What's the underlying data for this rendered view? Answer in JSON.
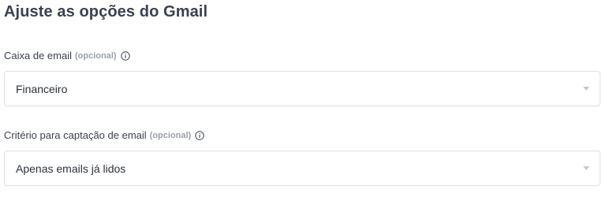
{
  "title": "Ajuste as opções do Gmail",
  "fields": [
    {
      "label": "Caixa de email",
      "optional": "(opcional)",
      "value": "Financeiro"
    },
    {
      "label": "Critério para captação de email",
      "optional": "(opcional)",
      "value": "Apenas emails já lidos"
    }
  ],
  "icons": {
    "info": "info-icon",
    "dropdown": "chevron-down-icon"
  },
  "colors": {
    "text": "#3a4150",
    "muted": "#9aa1ab",
    "border": "#dcdfe4"
  }
}
